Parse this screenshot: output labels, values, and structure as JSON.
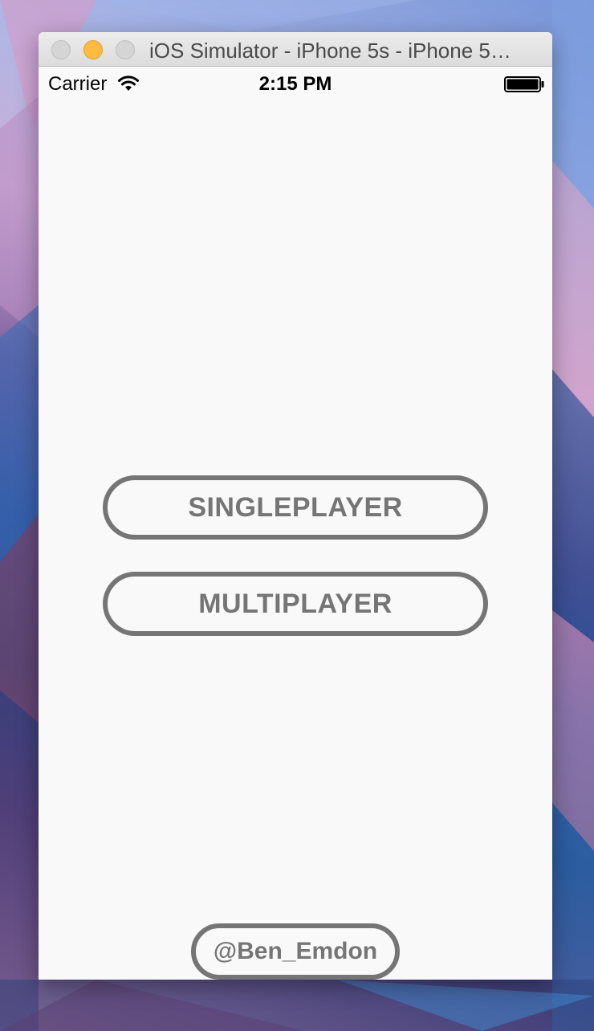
{
  "window": {
    "title": "iOS Simulator - iPhone 5s - iPhone 5…"
  },
  "statusbar": {
    "carrier": "Carrier",
    "time": "2:15 PM",
    "icons": [
      "wifi-icon",
      "battery-icon"
    ]
  },
  "menu": {
    "singleplayer_label": "SINGLEPLAYER",
    "multiplayer_label": "MULTIPLAYER",
    "credit_label": "@Ben_Emdon"
  },
  "colors": {
    "button_outline": "#757575",
    "screen_background": "#f9f9f9",
    "minimize_button": "#fdbc40"
  }
}
